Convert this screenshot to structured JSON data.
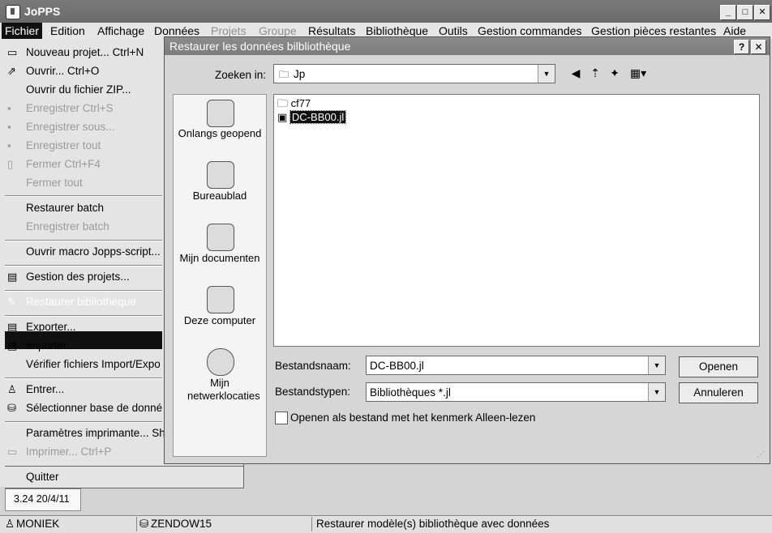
{
  "app": {
    "title": "JoPPS",
    "win_min": "_",
    "win_max": "□",
    "win_close": "✕"
  },
  "menubar": {
    "items": [
      "Fichier",
      "Edition",
      "Affichage",
      "Données",
      "Projets",
      "Groupe",
      "Résultats",
      "Bibliothèque",
      "Outils",
      "Gestion commandes",
      "Gestion pièces restantes",
      "Aide"
    ]
  },
  "file_menu": {
    "items": [
      {
        "label": "Nouveau projet... Ctrl+N",
        "icon": "new-project-icon"
      },
      {
        "label": "Ouvrir... Ctrl+O",
        "icon": "open-icon"
      },
      {
        "label": "Ouvrir du fichier ZIP..."
      },
      {
        "label": "Enregistrer Ctrl+S",
        "icon": "save-icon"
      },
      {
        "label": "Enregistrer sous...",
        "icon": "save-as-icon"
      },
      {
        "label": "Enregistrer tout",
        "icon": "save-all-icon"
      },
      {
        "label": "Fermer Ctrl+F4",
        "icon": "close-file-icon"
      },
      {
        "label": "Fermer tout"
      },
      {
        "label": "Restaurer batch"
      },
      {
        "label": "Enregistrer batch"
      },
      {
        "label": "Ouvrir macro Jopps-script..."
      },
      {
        "label": "Gestion des projets...",
        "icon": "projects-icon"
      },
      {
        "label": "Restaurer bibliothèque",
        "icon": "restore-library-icon"
      },
      {
        "label": "Exporter...",
        "icon": "export-icon"
      },
      {
        "label": "Importer...",
        "icon": "import-icon"
      },
      {
        "label": "Vérifier fichiers Import/Expo"
      },
      {
        "label": "Entrer...",
        "icon": "user-icon"
      },
      {
        "label": "Sélectionner base de donné",
        "icon": "database-question-icon"
      },
      {
        "label": "Paramètres imprimante... Sh"
      },
      {
        "label": "Imprimer... Ctrl+P",
        "icon": "printer-icon"
      },
      {
        "label": "Quitter"
      }
    ],
    "version": "3.24 20/4/11"
  },
  "statusbar": {
    "user": "MONIEK",
    "server": "ZENDOW15",
    "message": "Restaurer modèle(s) bibliothèque avec données"
  },
  "dialog": {
    "title": "Restaurer les données bilbliothèque",
    "help": "?",
    "close": "✕",
    "look_in_label": "Zoeken in:",
    "look_in_value": "Jp",
    "places": [
      "Onlangs geopend",
      "Bureaublad",
      "Mijn documenten",
      "Deze computer",
      "Mijn netwerklocaties"
    ],
    "files": [
      {
        "name": "cf77",
        "type": "folder"
      },
      {
        "name": "DC-BB00.jl",
        "type": "file"
      }
    ],
    "filename_label": "Bestandsnaam:",
    "filename_value": "DC-BB00.jl",
    "filetype_label": "Bestandstypen:",
    "filetype_value": "Bibliothèques *.jl",
    "readonly_label": "Openen als bestand met het kenmerk Alleen-lezen",
    "open_button": "Openen",
    "cancel_button": "Annuleren"
  }
}
